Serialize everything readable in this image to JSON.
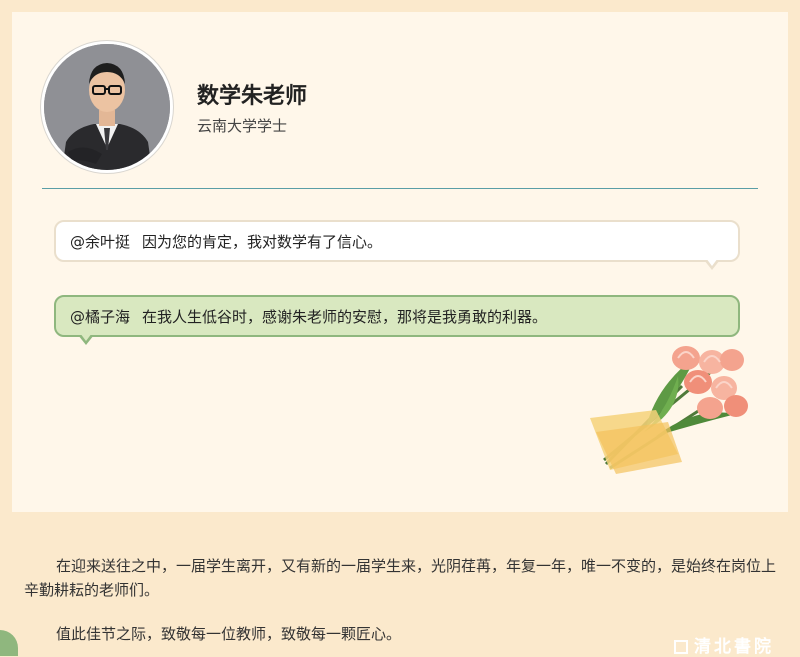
{
  "profile": {
    "name": "数学朱老师",
    "degree": "云南大学学士"
  },
  "comments": [
    {
      "user": "@余叶挺",
      "text": "因为您的肯定，我对数学有了信心。"
    },
    {
      "user": "@橘子海",
      "text": "在我人生低谷时，感谢朱老师的安慰，那将是我勇敢的利器。"
    }
  ],
  "paragraphs": [
    "在迎来送往之中，一届学生离开，又有新的一届学生来，光阴荏苒，年复一年，唯一不变的，是始终在岗位上辛勤耕耘的老师们。",
    "值此佳节之际，致敬每一位教师，致敬每一颗匠心。"
  ],
  "watermark": "清北書院",
  "colors": {
    "page_bg": "#fbe9cc",
    "card_bg": "#fff7ea",
    "divider": "#5a9ea6",
    "bubble_green": "#d9e8c0",
    "bubble_green_border": "#8fb77e"
  },
  "icons": {
    "avatar": "teacher-portrait",
    "decoration": "tulip-bouquet-icon"
  }
}
